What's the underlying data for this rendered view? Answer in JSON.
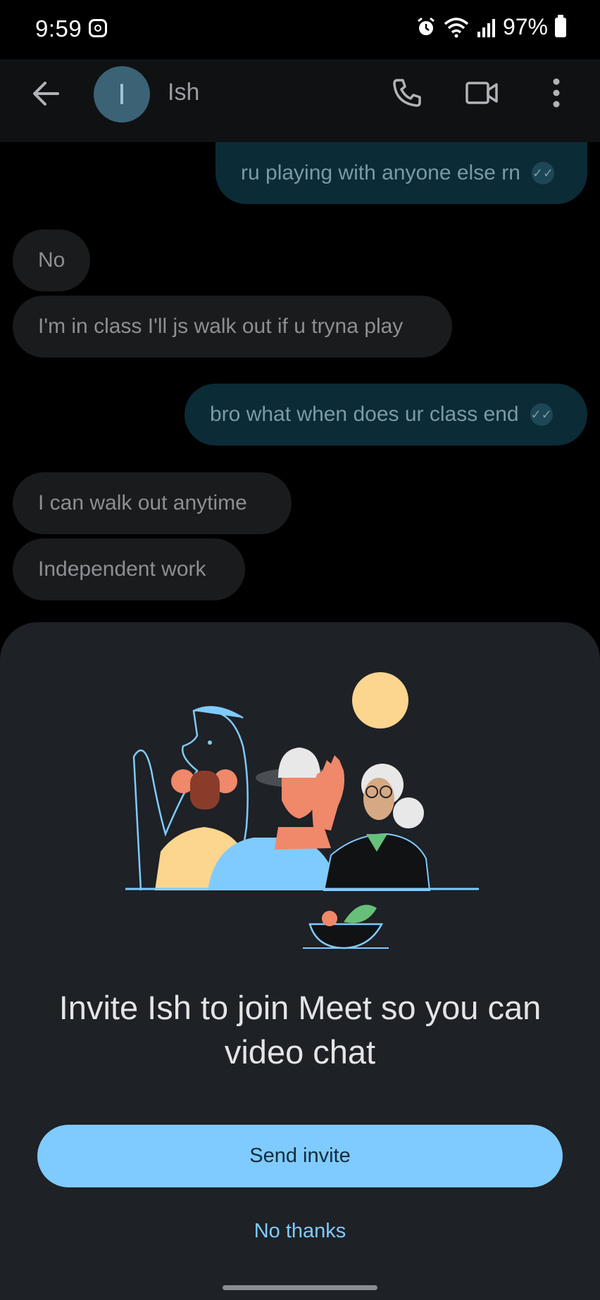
{
  "status_bar": {
    "time": "9:59",
    "battery": "97%"
  },
  "header": {
    "contact_initial": "I",
    "contact_name": "Ish"
  },
  "messages": [
    {
      "dir": "out",
      "text": "ru playing with anyone else rn"
    },
    {
      "dir": "in",
      "text": "No"
    },
    {
      "dir": "in",
      "text": "I'm in class I'll js walk out if u tryna play"
    },
    {
      "dir": "out",
      "text": "bro what when does ur class end"
    },
    {
      "dir": "in",
      "text": "I can walk out anytime"
    },
    {
      "dir": "in",
      "text": "Independent work"
    }
  ],
  "sheet": {
    "headline": "Invite Ish to join Meet so you can video chat",
    "primary_button": "Send invite",
    "secondary_button": "No thanks"
  },
  "colors": {
    "accent": "#7fcbff",
    "sheet_bg": "#1e2126",
    "outgoing_bubble": "#0b2b36",
    "incoming_bubble": "#1a1b1c"
  },
  "icons": [
    "instagram-icon",
    "alarm-icon",
    "wifi-icon",
    "signal-icon",
    "battery-icon",
    "back-arrow-icon",
    "phone-icon",
    "video-icon",
    "more-vert-icon",
    "read-check-icon"
  ]
}
